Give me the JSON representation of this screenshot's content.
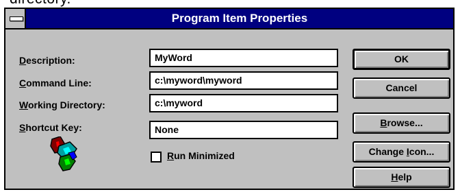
{
  "background_caption": "directory.",
  "window": {
    "title": "Program Item Properties"
  },
  "fields": {
    "description": {
      "label": "Description:",
      "value": "MyWord"
    },
    "command_line": {
      "label": "Command Line:",
      "value": "c:\\myword\\myword"
    },
    "working_directory": {
      "label": "Working Directory:",
      "value": "c:\\myword"
    },
    "shortcut_key": {
      "label": "Shortcut Key:",
      "value": "None"
    }
  },
  "checkbox": {
    "label": "Run Minimized",
    "checked": false
  },
  "buttons": {
    "ok": "OK",
    "cancel": "Cancel",
    "browse": "Browse...",
    "change_icon": "Change Icon...",
    "help": "Help"
  },
  "icons": {
    "system_menu": "system-menu-icon",
    "program": "program-icon"
  },
  "colors": {
    "title_bar": "#000080",
    "title_text": "#ffffff",
    "dialog_face": "#c0c0c0"
  }
}
